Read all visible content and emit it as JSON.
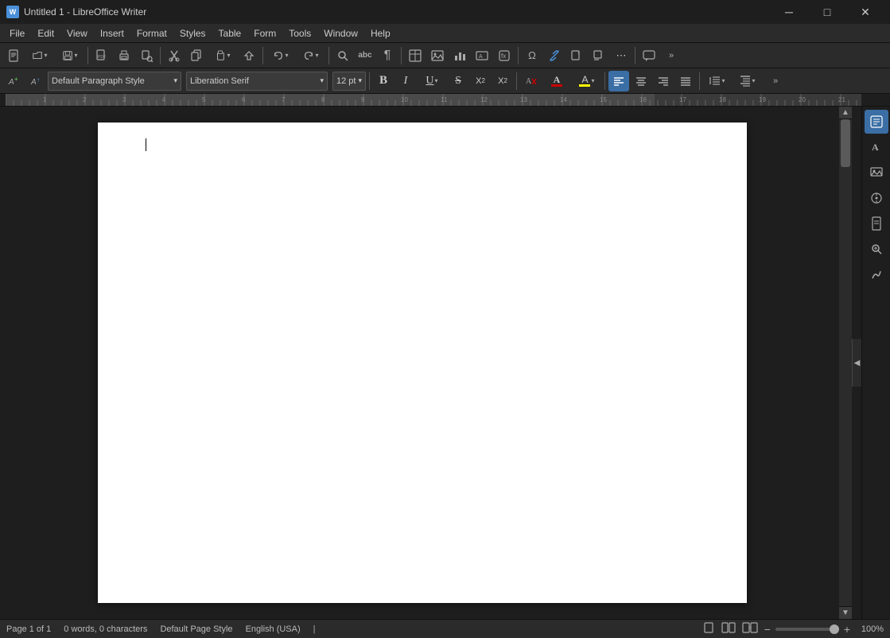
{
  "titlebar": {
    "title": "Untitled 1 - LibreOffice Writer",
    "app_icon": "W",
    "minimize": "─",
    "maximize": "□",
    "close": "✕"
  },
  "menu": {
    "items": [
      "File",
      "Edit",
      "View",
      "Insert",
      "Format",
      "Styles",
      "Table",
      "Form",
      "Tools",
      "Window",
      "Help"
    ]
  },
  "toolbar1": {
    "buttons": [
      {
        "name": "new",
        "icon": "📄"
      },
      {
        "name": "open",
        "icon": "📂"
      },
      {
        "name": "save",
        "icon": "💾"
      },
      {
        "name": "export-pdf",
        "icon": "📋"
      },
      {
        "name": "print",
        "icon": "🖨"
      },
      {
        "name": "print-preview",
        "icon": "🔍"
      },
      {
        "name": "cut",
        "icon": "✂"
      },
      {
        "name": "copy",
        "icon": "📑"
      },
      {
        "name": "paste",
        "icon": "📋"
      },
      {
        "name": "clone-format",
        "icon": "🖌"
      },
      {
        "name": "undo",
        "icon": "↩"
      },
      {
        "name": "redo",
        "icon": "↪"
      },
      {
        "name": "find",
        "icon": "🔍"
      },
      {
        "name": "spellcheck",
        "icon": "abc"
      },
      {
        "name": "formatting-marks",
        "icon": "¶"
      },
      {
        "name": "insert-table",
        "icon": "⊞"
      },
      {
        "name": "insert-image",
        "icon": "🖼"
      },
      {
        "name": "insert-chart",
        "icon": "📊"
      },
      {
        "name": "insert-textbox",
        "icon": "▬"
      },
      {
        "name": "insert-field",
        "icon": "⊡"
      },
      {
        "name": "insert-special",
        "icon": "Ω"
      },
      {
        "name": "insert-link",
        "icon": "🔗"
      },
      {
        "name": "insert-endnote",
        "icon": "⌶"
      },
      {
        "name": "insert-footnote",
        "icon": "📝"
      },
      {
        "name": "more1",
        "icon": "⋯"
      },
      {
        "name": "comment",
        "icon": "💬"
      },
      {
        "name": "more2",
        "icon": "»"
      }
    ]
  },
  "toolbar2": {
    "paragraph_style": "Default Paragraph Style",
    "paragraph_style_arrow": "▾",
    "font_name": "Liberation Serif",
    "font_name_arrow": "▾",
    "font_size": "12 pt",
    "font_size_arrow": "▾",
    "bold": "B",
    "italic": "I",
    "underline": "U",
    "strikethrough": "S",
    "superscript": "X²",
    "subscript": "X₂",
    "clear_format": "A",
    "font_color": "A",
    "highlight": "A",
    "align_left": "≡",
    "align_center": "≡",
    "align_right": "≡",
    "justify": "≡",
    "line_spacing": "≡",
    "more": "»"
  },
  "statusbar": {
    "page_info": "Page 1 of 1",
    "word_count": "0 words, 0 characters",
    "page_style": "Default Page Style",
    "language": "English (USA)",
    "text_mode": "",
    "zoom": "100%",
    "view_icons": [
      "▬",
      "▬▬",
      "▬▬▬"
    ]
  },
  "side_panel": {
    "buttons": [
      {
        "name": "properties",
        "icon": "⊞",
        "active": true
      },
      {
        "name": "styles",
        "icon": "A"
      },
      {
        "name": "gallery",
        "icon": "🖼"
      },
      {
        "name": "navigator",
        "icon": "◎"
      },
      {
        "name": "page",
        "icon": "📄"
      },
      {
        "name": "find-replace",
        "icon": "🔎"
      },
      {
        "name": "signatures",
        "icon": "✒"
      }
    ]
  }
}
